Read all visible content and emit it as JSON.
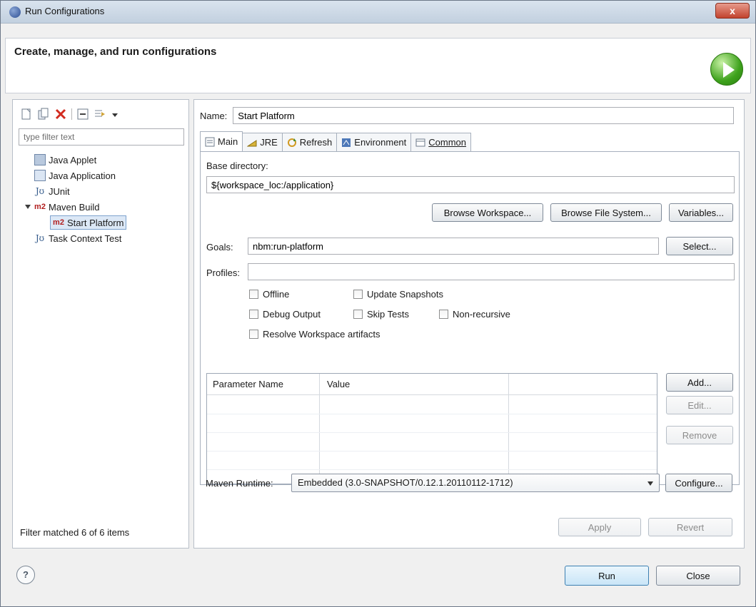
{
  "window": {
    "title": "Run Configurations",
    "close_label": "x"
  },
  "header": {
    "title": "Create, manage, and run configurations"
  },
  "left": {
    "filter_placeholder": "type filter text",
    "tree": [
      {
        "label": "Java Applet",
        "icon": "java-applet-icon"
      },
      {
        "label": "Java Application",
        "icon": "java-application-icon"
      },
      {
        "label": "JUnit",
        "icon": "junit-icon"
      },
      {
        "label": "Maven Build",
        "icon": "m2-icon"
      },
      {
        "label": "Start Platform",
        "icon": "m2-icon",
        "selected": true
      },
      {
        "label": "Task Context Test",
        "icon": "junit-icon"
      }
    ],
    "filter_status": "Filter matched 6 of 6 items"
  },
  "right": {
    "name_label": "Name:",
    "name_value": "Start Platform",
    "tabs": [
      {
        "label": "Main"
      },
      {
        "label": "JRE"
      },
      {
        "label": "Refresh"
      },
      {
        "label": "Environment"
      },
      {
        "label": "Common"
      }
    ],
    "base_dir_label": "Base directory:",
    "base_dir_value": "${workspace_loc:/application}",
    "browse_workspace": "Browse Workspace...",
    "browse_file_system": "Browse File System...",
    "variables": "Variables...",
    "goals_label": "Goals:",
    "goals_value": "nbm:run-platform",
    "select_button": "Select...",
    "profiles_label": "Profiles:",
    "profiles_value": "",
    "checkboxes": {
      "offline": "Offline",
      "update_snapshots": "Update Snapshots",
      "debug_output": "Debug Output",
      "skip_tests": "Skip Tests",
      "non_recursive": "Non-recursive",
      "resolve_workspace": "Resolve Workspace artifacts"
    },
    "params_header": [
      "Parameter Name",
      "Value",
      ""
    ],
    "add_button": "Add...",
    "edit_button": "Edit...",
    "remove_button": "Remove",
    "maven_runtime_label": "Maven Runtime:",
    "maven_runtime_value": "Embedded (3.0-SNAPSHOT/0.12.1.20110112-1712)",
    "configure_button": "Configure...",
    "apply_button": "Apply",
    "revert_button": "Revert"
  },
  "footer": {
    "run_button": "Run",
    "close_button": "Close"
  }
}
